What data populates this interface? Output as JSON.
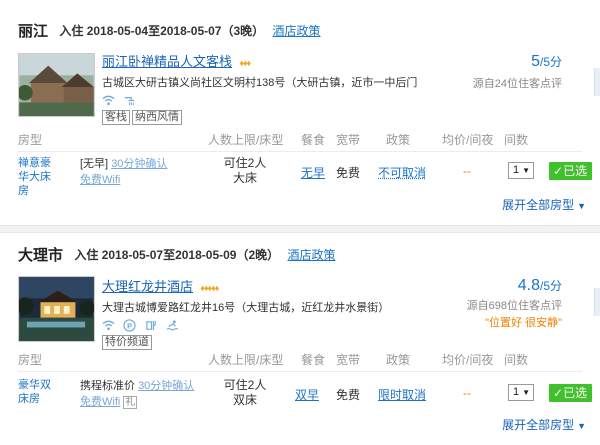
{
  "blocks": [
    {
      "city": "丽江",
      "dates": "入住  2018-05-04至2018-05-07（3晚）",
      "policy_link": "酒店政策",
      "hotel_name": "丽江卧禅精品人文客栈",
      "stars": "♦♦♦",
      "address": "古城区大研古镇义尚社区文明村138号（大研古镇，近市一中后门",
      "facility_icons": [
        "wifi-icon",
        "shower-icon"
      ],
      "tags": [
        "客栈",
        "纳西风情"
      ],
      "score": "5",
      "score_suffix": "/5分",
      "reviews": "源自24位住客点评",
      "praise": "",
      "table_header": {
        "room": "房型",
        "capacity": "人数上限/床型",
        "meal": "餐食",
        "broadband": "宽带",
        "policy": "政策",
        "price": "均价/间夜",
        "count": "间数"
      },
      "room": {
        "name": "禅意豪华大床房",
        "option_line1_a": "[无早]",
        "option_line1_b": "30分钟确认",
        "option_line2": "免费Wifi",
        "option_badge": "",
        "capacity_line1": "可住2人",
        "capacity_line2": "大床",
        "meal": "无早",
        "broadband": "免费",
        "policy": "不可取消",
        "price": "--",
        "count": "1",
        "selected": "已选"
      },
      "expand": "展开全部房型"
    },
    {
      "city": "大理市",
      "dates": "入住  2018-05-07至2018-05-09（2晚）",
      "policy_link": "酒店政策",
      "hotel_name": "大理红龙井酒店",
      "stars": "♦♦♦♦♦",
      "address": "大理古城博爱路红龙井16号（大理古城，近红龙井水景街）",
      "facility_icons": [
        "wifi-icon",
        "parking-icon",
        "restaurant-icon",
        "pool-icon"
      ],
      "tags": [
        "特价频道"
      ],
      "score": "4.8",
      "score_suffix": "/5分",
      "reviews": "源自698位住客点评",
      "praise": "\"位置好 很安静\"",
      "table_header": {
        "room": "房型",
        "capacity": "人数上限/床型",
        "meal": "餐食",
        "broadband": "宽带",
        "policy": "政策",
        "price": "均价/间夜",
        "count": "间数"
      },
      "room": {
        "name": "豪华双床房",
        "option_line1_a": "携程标准价",
        "option_line1_b": "30分钟确认",
        "option_line2": "免费Wifi",
        "option_badge": "礼",
        "capacity_line1": "可住2人",
        "capacity_line2": "双床",
        "meal": "双早",
        "broadband": "免费",
        "policy": "限时取消",
        "price": "--",
        "count": "1",
        "selected": "已选"
      },
      "expand": "展开全部房型"
    }
  ],
  "colors": {
    "link": "#1a73c8",
    "selected_green": "#41c02d",
    "price_orange": "#f08300"
  }
}
